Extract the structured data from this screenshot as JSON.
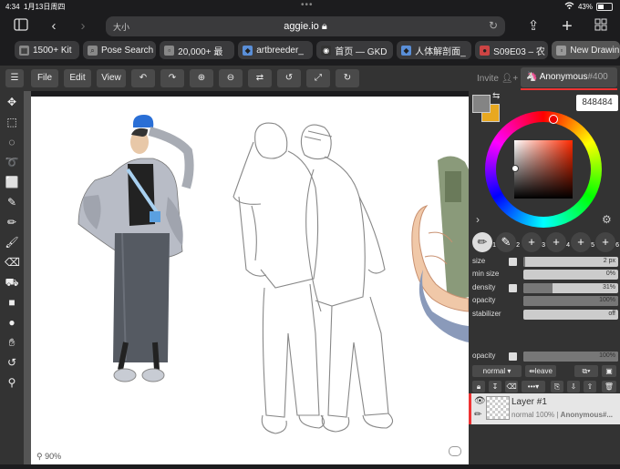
{
  "statusbar": {
    "time": "4:34",
    "date": "1月13日周四",
    "battery": "43%",
    "battery_level": 0.43
  },
  "browser": {
    "aa": "大小",
    "url": "aggie.io",
    "tabs": [
      {
        "label": "1500+ Kit"
      },
      {
        "label": "Pose Search"
      },
      {
        "label": "20,000+ 最"
      },
      {
        "label": "artbreeder_"
      },
      {
        "label": "首页 — GKD"
      },
      {
        "label": "人体解剖面_"
      },
      {
        "label": "S09E03 – 农"
      },
      {
        "label": "New Drawin"
      }
    ]
  },
  "toolbar": {
    "file": "File",
    "edit": "Edit",
    "view": "View",
    "invite": "Invite",
    "user": "Anonymous",
    "user_id": "#400"
  },
  "color": {
    "hex": "848484",
    "primary": "#848484",
    "secondary": "#e8a820"
  },
  "brushes": [
    "1",
    "2",
    "3",
    "4",
    "5",
    "6"
  ],
  "properties": [
    {
      "label": "size",
      "value": "2 px",
      "fill": 0.02
    },
    {
      "label": "min size",
      "value": "0%",
      "fill": 0
    },
    {
      "label": "density",
      "value": "31%",
      "fill": 0.31
    },
    {
      "label": "opacity",
      "value": "100%",
      "fill": 1
    },
    {
      "label": "stabilizer",
      "value": "off",
      "fill": 0
    }
  ],
  "layer_opacity": {
    "label": "opacity",
    "value": "100%"
  },
  "blend": {
    "mode": "normal",
    "leave": "leave"
  },
  "layer": {
    "name": "Layer #1",
    "blend": "normal 100%",
    "owner": "Anonymous#..."
  },
  "canvas": {
    "zoom": "90%"
  }
}
